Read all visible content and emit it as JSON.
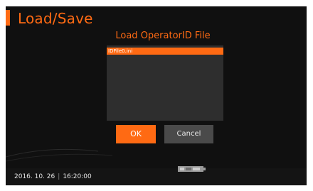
{
  "header": {
    "title": "Load/Save"
  },
  "dialog": {
    "title": "Load OperatorID File",
    "files": [
      "IDFile0.ini"
    ],
    "ok_label": "OK",
    "cancel_label": "Cancel"
  },
  "status": {
    "date": "2016. 10. 26",
    "separator": "|",
    "time": "16:20:00",
    "device_icon": "device-status-icon"
  },
  "colors": {
    "accent": "#ff6a13",
    "background": "#101010",
    "list_background": "#2e2e2e",
    "cancel_button": "#4a4a4a"
  }
}
